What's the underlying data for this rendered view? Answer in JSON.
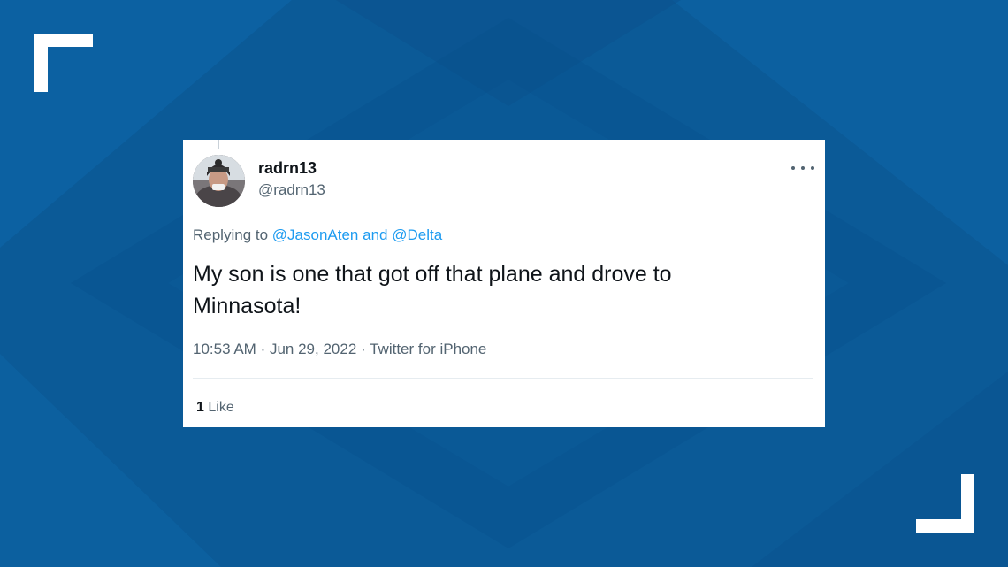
{
  "tweet": {
    "display_name": "radrn13",
    "handle": "@radrn13",
    "replying_prefix": "Replying to",
    "reply_to_1": "@JasonAten",
    "reply_and": "and",
    "reply_to_2": "@Delta",
    "text_line1": "My son is one that got off that plane and drove to",
    "text_line2": "Minnasota!",
    "time": "10:53 AM",
    "sep1": "·",
    "date": "Jun 29, 2022",
    "sep2": "·",
    "source": "Twitter for iPhone",
    "like_count": "1",
    "like_label": "Like",
    "more_icon": "more-horizontal-icon",
    "avatar_icon": "user-avatar"
  },
  "colors": {
    "background": "#0b5a97",
    "card": "#ffffff",
    "link": "#1d9bf0",
    "secondary_text": "#536471",
    "primary_text": "#0f1419"
  }
}
